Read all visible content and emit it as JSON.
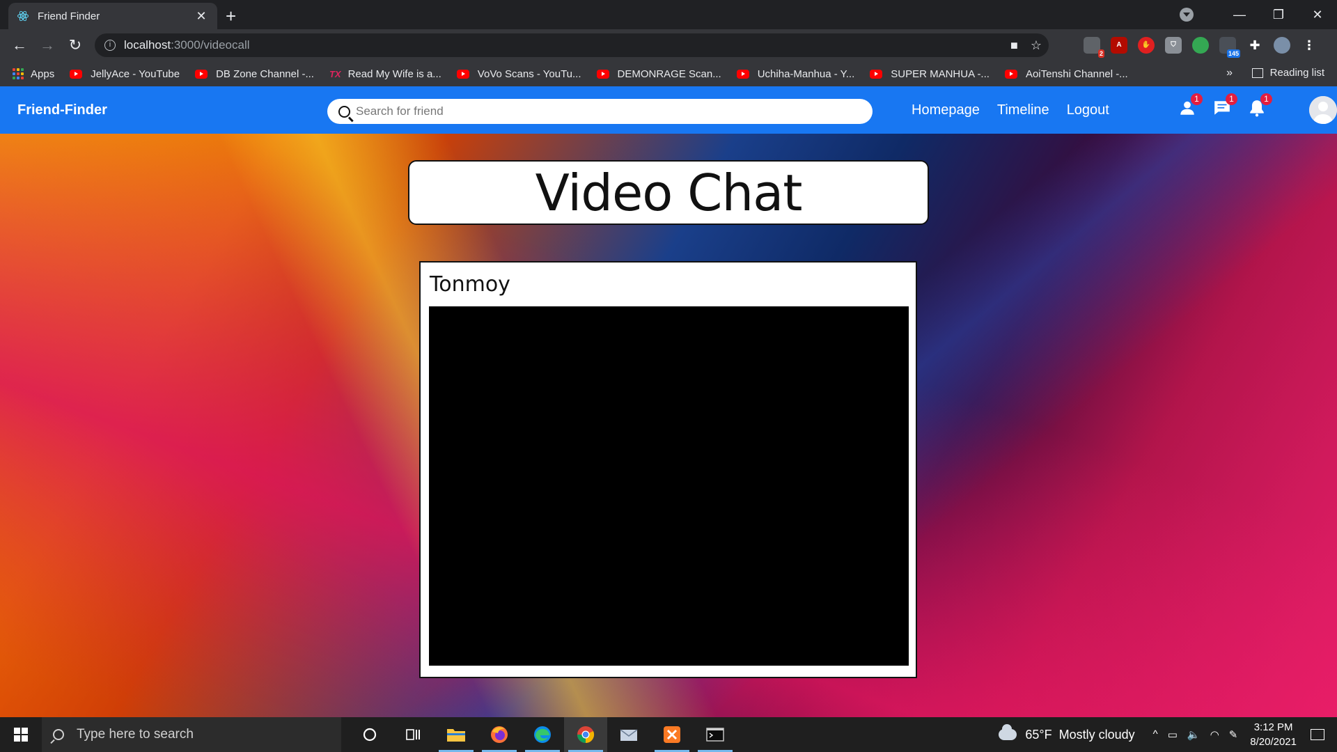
{
  "browser": {
    "tab_title": "Friend Finder",
    "tab_close": "✕",
    "new_tab": "+",
    "url_host": "localhost",
    "url_path": ":3000/videocall",
    "window_controls": [
      "—",
      "❐",
      "✕"
    ],
    "extension_badges": {
      "ext1": "2",
      "ext6": "145"
    },
    "bookmarks": [
      "Apps",
      "JellyAce - YouTube",
      "DB Zone Channel -...",
      "Read My Wife is a...",
      "VoVo Scans - YouTu...",
      "DEMONRAGE Scan...",
      "Uchiha-Manhua - Y...",
      "SUPER MANHUA -...",
      "AoiTenshi Channel -..."
    ],
    "bookmarks_more": "»",
    "reading_list": "Reading list"
  },
  "app": {
    "brand": "Friend-Finder",
    "search_placeholder": "Search for friend",
    "nav_links": [
      "Homepage",
      "Timeline",
      "Logout"
    ],
    "badges": {
      "friend_requests": "1",
      "messages": "1",
      "notifications": "1"
    },
    "accent_color": "#1877f2"
  },
  "main": {
    "title": "Video Chat",
    "caller_name": "Tonmoy"
  },
  "taskbar": {
    "search_placeholder": "Type here to search",
    "weather_temp": "65°F",
    "weather_desc": "Mostly cloudy",
    "time": "3:12 PM",
    "date": "8/20/2021"
  }
}
